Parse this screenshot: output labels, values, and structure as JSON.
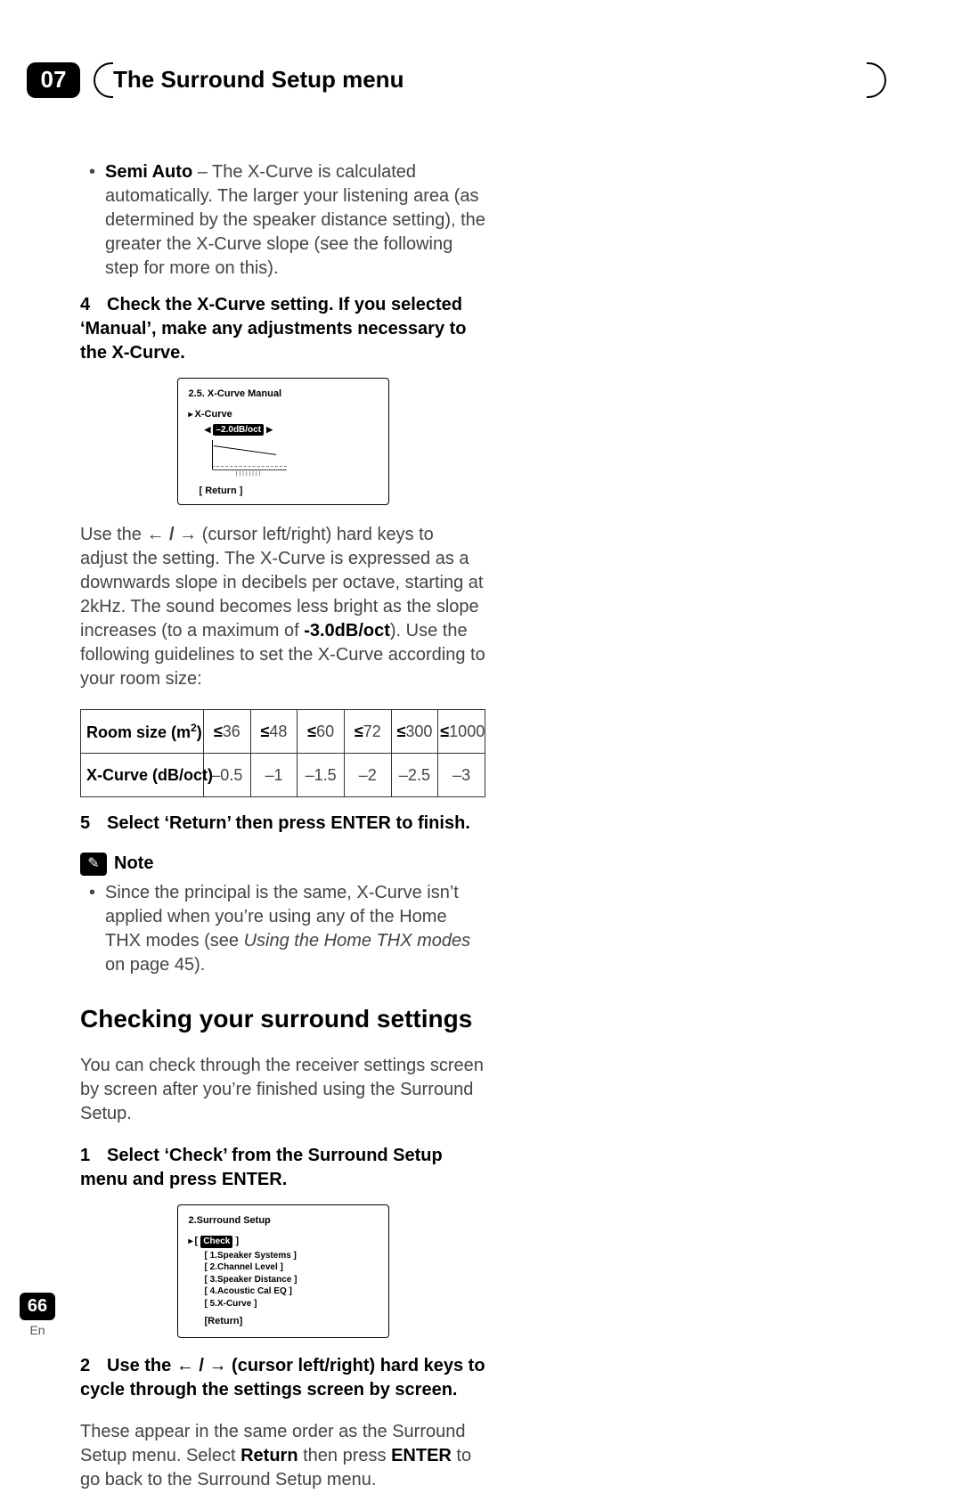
{
  "header": {
    "chapter_num": "07",
    "title": "The Surround Setup menu"
  },
  "semiAuto": {
    "label": "Semi Auto",
    "desc": " – The X-Curve is calculated automatically. The larger your listening area (as determined by the speaker distance setting), the greater the X-Curve slope (see the following step for more on this)."
  },
  "step4": {
    "num": "4",
    "text": "Check the X-Curve setting. If you selected ‘Manual’, make any adjustments necessary to the X-Curve."
  },
  "osd1": {
    "title": "2.5. X-Curve  Manual",
    "param_label": "X-Curve",
    "value": "–2.0dB/oct",
    "return": "[  Return  ]"
  },
  "paraA": {
    "p1": "Use the ",
    "p2": " (cursor left/right) hard keys to adjust the setting. The X-Curve is expressed as a downwards slope in decibels per octave, starting at 2kHz. The sound becomes less bright as the slope increases (to a maximum of ",
    "max": "-3.0dB/oct",
    "p3": "). Use the following guidelines to set the X-Curve according to your room size:"
  },
  "table": {
    "row1Label": "Room size (m",
    "row1Sup": "2",
    "row1Close": ")",
    "row2Label": "X-Curve (dB/oct)",
    "le": "≤",
    "cols": [
      "36",
      "48",
      "60",
      "72",
      "300",
      "1000"
    ],
    "vals": [
      "–0.5",
      "–1",
      "–1.5",
      "–2",
      "–2.5",
      "–3"
    ]
  },
  "step5": {
    "num": "5",
    "text": "Select ‘Return’ then press ENTER to finish."
  },
  "note": {
    "label": "Note",
    "bullet_a": "Since the principal is the same, X-Curve isn’t applied when you’re using any of the Home THX modes (see ",
    "bullet_i": "Using the Home THX modes",
    "bullet_b": " on page 45)."
  },
  "sec2": {
    "heading": "Checking your surround settings",
    "intro": "You can check through the receiver settings screen by screen after you’re finished using the Surround Setup."
  },
  "step1b": {
    "num": "1",
    "text": "Select ‘Check’ from the Surround Setup menu and press ENTER."
  },
  "osd2": {
    "title": "2.Surround Setup",
    "check": "Check",
    "items": [
      "[ 1.Speaker Systems ]",
      "[ 2.Channel Level ]",
      "[ 3.Speaker Distance ]",
      "[ 4.Acoustic Cal EQ ]",
      "[ 5.X-Curve ]"
    ],
    "return": "[Return]"
  },
  "step2b": {
    "num": "2",
    "text_a": "Use the ",
    "text_b": " (cursor left/right) hard keys to cycle through the settings screen by screen."
  },
  "paraB": {
    "a": "These appear in the same order as the Surround Setup menu. Select ",
    "ret": "Return",
    "b": " then press ",
    "ent": "ENTER",
    "c": " to go back to the Surround Setup menu."
  },
  "footer": {
    "page": "66",
    "lang": "En"
  },
  "glyph": {
    "arrows": "← / →",
    "pencil": "✎"
  }
}
